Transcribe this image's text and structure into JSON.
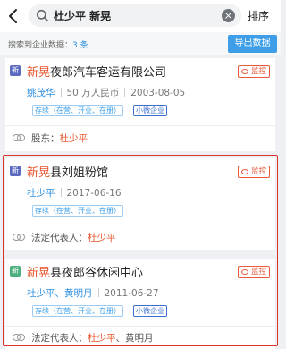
{
  "header": {
    "search_value": "杜少平 新晃",
    "sort_label": "排序"
  },
  "summary": {
    "prefix": "搜索到企业数据：",
    "count": "3 条",
    "export_label": "导出数据"
  },
  "colors": {
    "accent": "#3e9fe8",
    "highlight": "#e8542c",
    "box": "#d9342b"
  },
  "results": [
    {
      "logo": "新",
      "logo_color": "#5c6bc0",
      "name_hl": "新晃",
      "name_rest": "夜郎汽车客运有限公司",
      "monitor": "监控",
      "person": "姚茂华",
      "capital": "50 万人民币",
      "date": "2003-08-05",
      "status_tag": "存续（在营、开业、在册）",
      "size_tag": "小微企业",
      "foot_label": "股东：",
      "foot_value": "杜少平",
      "foot_extra": ""
    },
    {
      "logo": "新",
      "logo_color": "#5c6bc0",
      "name_hl": "新晃",
      "name_rest": "县刘姐粉馆",
      "monitor": "监控",
      "person": "杜少平",
      "date": "2017-06-16",
      "status_tag": "存续（在营、开业、在册）",
      "foot_label": "法定代表人：",
      "foot_value": "杜少平",
      "foot_extra": ""
    },
    {
      "logo": "新",
      "logo_color": "#4caf7d",
      "name_hl": "新晃",
      "name_rest": "县夜郎谷休闲中心",
      "monitor": "监控",
      "person": "杜少平、黄明月",
      "date": "2011-06-27",
      "status_tag": "存续（在营、开业、在册）",
      "size_tag": "小微企业",
      "foot_label": "法定代表人：",
      "foot_value": "杜少平",
      "foot_extra": "、黄明月"
    }
  ]
}
